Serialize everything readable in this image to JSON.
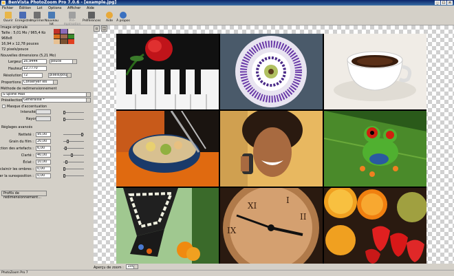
{
  "window": {
    "title": "BenVista PhotoZoom Pro 7.0.6 - [example.jpg]"
  },
  "menu": [
    "Fichier",
    "Édition",
    "Lot",
    "Options",
    "Afficher",
    "Aide"
  ],
  "toolbar": {
    "buttons": [
      {
        "label": "Ouvrir",
        "icon": "folder-open-icon",
        "color": "#e8b64a"
      },
      {
        "label": "Enregistrer",
        "icon": "save-icon",
        "color": "#4a6bb4"
      },
      {
        "label": "Imprimer",
        "icon": "printer-icon",
        "color": "#707070"
      },
      {
        "label": "Nouveau lot",
        "icon": "batch-icon",
        "color": "#4a7ab4"
      },
      {
        "label": "Pré-égalisation",
        "icon": "levels-icon",
        "color": "#a0a0a0",
        "disabled": true
      },
      {
        "label": "Préférences",
        "icon": "tools-icon",
        "color": "#606060"
      },
      {
        "label": "Aide",
        "icon": "help-icon",
        "color": "#e8a93a"
      },
      {
        "label": "À propos",
        "icon": "info-icon",
        "color": "#3a70c0"
      }
    ]
  },
  "original": {
    "header": "Image originale",
    "size_text": "Taille : 5,01 Mo / 965,4 Ko",
    "dims_text": "968x8",
    "inch_text": "16,94 x 12,78 pouces",
    "res_text": "72 pixels/pouce"
  },
  "new_dims": {
    "header": "Nouvelles dimensions (5,21 Mo)",
    "width_label": "Largeur :",
    "width_value": "16,9444",
    "width_unit": "pouce",
    "height_label": "Hauteur :",
    "height_value": "12,7770",
    "res_label": "Résolution :",
    "res_value": "72",
    "res_unit": "pixels/pouce",
    "proportions_label": "Proportions :",
    "proportions_value": "Conserver les proportions"
  },
  "method": {
    "header": "Méthode de redimensionnement",
    "method_value": "S-Spline Max",
    "preset_label": "Présélection :",
    "preset_value": "Généralisé *",
    "sharpen_check": "Masque d'accentuation",
    "intensity_label": "Intensité :",
    "radius_label": "Rayon :",
    "advanced_header": "Réglages avancés",
    "settings": [
      {
        "label": "Netteté :",
        "value": "95,00",
        "level": 0.95
      },
      {
        "label": "Grain du film :",
        "value": "20,00",
        "level": 0.2
      },
      {
        "label": "Réduction des artefacts :",
        "value": "6,00",
        "level": 0.06
      },
      {
        "label": "Clarté :",
        "value": "40,00",
        "level": 0.4
      },
      {
        "label": "Éclat :",
        "value": "10,00",
        "level": 0.1
      },
      {
        "label": "Éclaircir les ombres :",
        "value": "0,00",
        "level": 0.0
      },
      {
        "label": "Corriger la surexposition :",
        "value": "0,00",
        "level": 0.0
      }
    ],
    "profiles_button": "Profils de redimensionnement..."
  },
  "zoombar": {
    "label": "Aperçu de zoom :",
    "value": "100%"
  },
  "status": "PhotoZoom Pro 7",
  "photos": [
    "rose-piano",
    "passion-flower",
    "coffee-cup",
    "grilled-food",
    "smiling-woman",
    "tree-frog",
    "butterfly",
    "clock",
    "fruits"
  ]
}
